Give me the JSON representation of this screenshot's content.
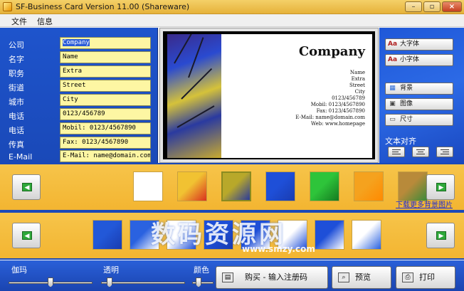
{
  "window": {
    "title": "SF-Business Card  Version 11.00 (Shareware)",
    "minimize": "–",
    "maximize": "▫",
    "close": "×"
  },
  "menu": [
    "文件",
    "信息"
  ],
  "fields": [
    {
      "label": "公司",
      "value": "Company",
      "selected": true
    },
    {
      "label": "名字",
      "value": "Name"
    },
    {
      "label": "职务",
      "value": "Extra"
    },
    {
      "label": "街道",
      "value": "Street"
    },
    {
      "label": "城市",
      "value": "City"
    },
    {
      "label": "电话",
      "value": "0123/456789"
    },
    {
      "label": "电话",
      "value": "Mobil: 0123/4567890"
    },
    {
      "label": "传真",
      "value": "Fax: 0123/4567890"
    },
    {
      "label": "E-Mail",
      "value": "E-Mail: name@domain.com"
    }
  ],
  "card": {
    "company": "Company",
    "lines": [
      "Name",
      "Extra",
      "Street",
      "City",
      "0123/456789",
      "Mobil: 0123/4567890",
      "Fax: 0123/4567890",
      "E-Mail: name@domain.com",
      "Web: www.homepage"
    ]
  },
  "side_buttons": [
    {
      "label": "大字体",
      "icon": "font-larger-icon",
      "glyph": "Aa"
    },
    {
      "label": "小字体",
      "icon": "font-smaller-icon",
      "glyph": "Aa"
    },
    {
      "label": "背景",
      "icon": "background-icon",
      "glyph": "▦"
    },
    {
      "label": "图像",
      "icon": "image-icon",
      "glyph": "▣"
    },
    {
      "label": "尺寸",
      "icon": "size-icon",
      "glyph": "▭"
    }
  ],
  "align_label": "文本对齐",
  "strip1": {
    "thumbs": [
      {
        "colors": [
          "#ffffff",
          "#ffffff"
        ]
      },
      {
        "colors": [
          "#f1c232",
          "#d9301e"
        ]
      },
      {
        "colors": [
          "#b8a82a",
          "#2a3a9a"
        ],
        "selected": true
      },
      {
        "colors": [
          "#1e4fd8",
          "#1a3cb0"
        ]
      },
      {
        "colors": [
          "#2ec43a",
          "#147a20"
        ]
      },
      {
        "colors": [
          "#f5a21e",
          "#ff8a00"
        ]
      },
      {
        "colors": [
          "#b88a3a",
          "#3a8a3a"
        ]
      }
    ],
    "download_link": "下载更多背景图片"
  },
  "strip2": {
    "thumbs": [
      {
        "colors": [
          "#2258d8",
          "#1a3cb0"
        ]
      },
      {
        "colors": [
          "#2a62e0",
          "#ffffff"
        ]
      },
      {
        "colors": [
          "#ffffff",
          "#1e4fd8"
        ]
      },
      {
        "colors": [
          "#1e4fd8",
          "#1a3cb0"
        ]
      },
      {
        "colors": [
          "#1e4fd8",
          "#ffffff"
        ]
      },
      {
        "colors": [
          "#ffffff",
          "#1e4fd8"
        ]
      },
      {
        "colors": [
          "#1e4fd8",
          "#ffffff"
        ]
      },
      {
        "colors": [
          "#ffffff",
          "#2a62e0"
        ]
      }
    ]
  },
  "sliders": [
    {
      "label": "伽玛",
      "value": 0.5
    },
    {
      "label": "透明",
      "value": 0.1
    },
    {
      "label": "颜色",
      "value": 0.3
    }
  ],
  "actions": {
    "buy": "购买 - 输入注册码",
    "preview": "预览",
    "print": "打印"
  },
  "watermark": {
    "main": "数码资源网",
    "sub": "www.smzy.com"
  },
  "colors": {
    "panel_blue": "#1e54cc",
    "strip_gold": "#f3b531",
    "input_yellow": "#fdf6a3"
  }
}
